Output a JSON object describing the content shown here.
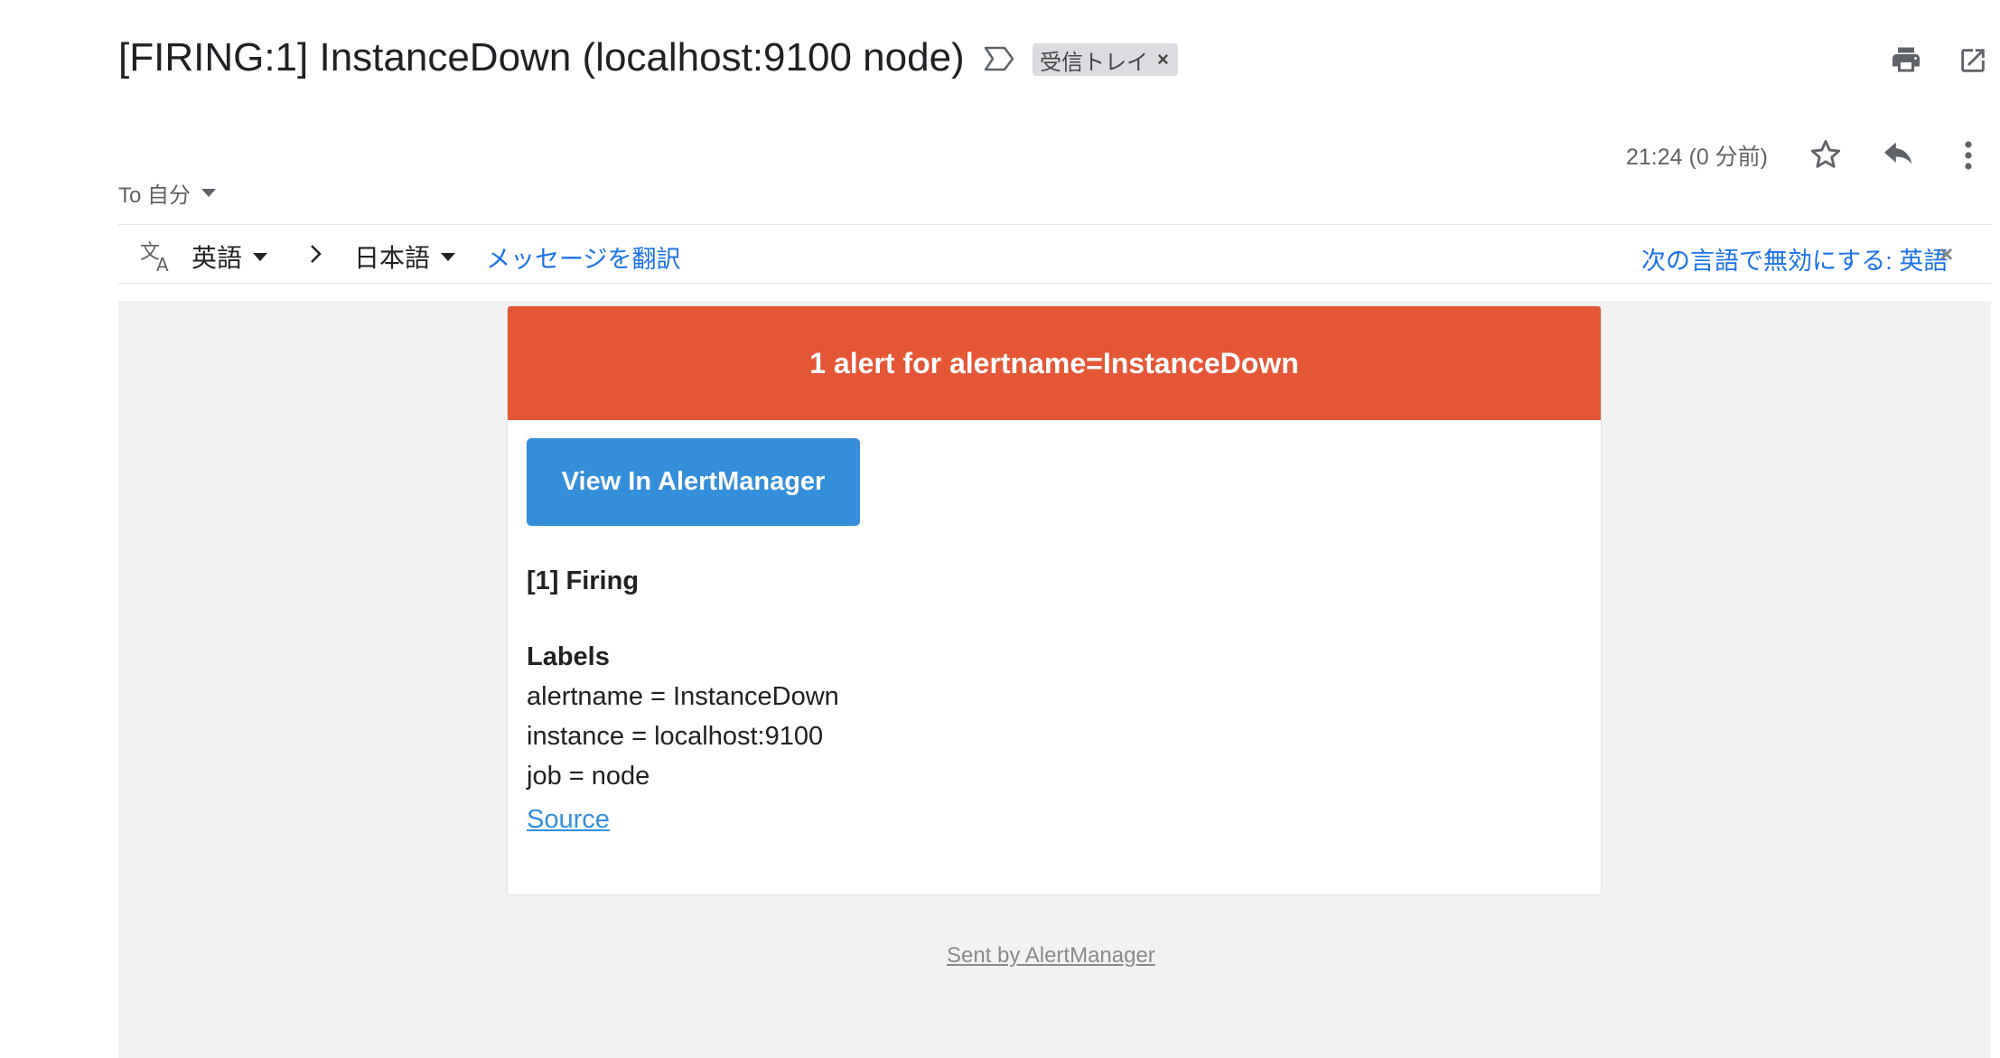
{
  "subject": "[FIRING:1] InstanceDown (localhost:9100 node)",
  "label_chip": {
    "text": "受信トレイ",
    "close": "×"
  },
  "header_actions": {
    "print_icon": "print-icon",
    "popout_icon": "open-in-new-window-icon"
  },
  "meta": {
    "timestamp": "21:24 (0 分前)",
    "to_line": "To 自分"
  },
  "translate_bar": {
    "source_lang": "英語",
    "target_lang": "日本語",
    "translate_link": "メッセージを翻訳",
    "disable_link": "次の言語で無効にする: 英語",
    "disable_close": "×"
  },
  "email": {
    "header": "1 alert for alertname=InstanceDown",
    "button": "View In AlertManager",
    "firing_title": "[1] Firing",
    "labels_title": "Labels",
    "labels": [
      "alertname = InstanceDown",
      "instance = localhost:9100",
      "job = node"
    ],
    "source_link": "Source",
    "footer": "Sent by AlertManager"
  },
  "colors": {
    "alert_header": "#e45635",
    "button": "#348eda",
    "link": "#1a73e8"
  }
}
